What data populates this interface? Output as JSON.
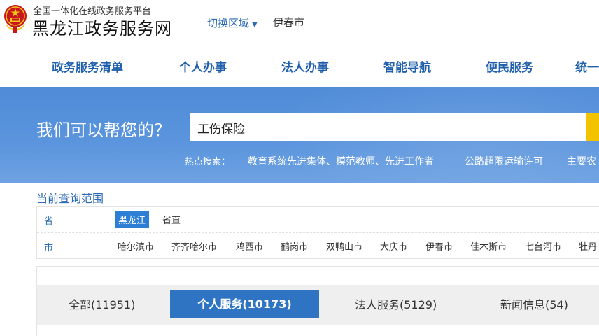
{
  "header": {
    "platform_subtitle": "全国一体化在线政务服务平台",
    "platform_title": "黑龙江政务服务网",
    "region_switch_label": "切换区域",
    "region_current": "伊春市"
  },
  "nav": {
    "items": [
      {
        "label": "政务服务清单"
      },
      {
        "label": "个人办事"
      },
      {
        "label": "法人办事"
      },
      {
        "label": "智能导航"
      },
      {
        "label": "便民服务"
      },
      {
        "label": "统一"
      }
    ]
  },
  "banner": {
    "prompt": "我们可以帮您的？",
    "search_value": "工伤保险",
    "hot_label": "热点搜索：",
    "hot_items": [
      {
        "label": "教育系统先进集体、模范教师、先进工作者"
      },
      {
        "label": "公路超限运输许可"
      },
      {
        "label": "主要农"
      }
    ]
  },
  "scope": {
    "title": "当前查询范围",
    "province_label": "省",
    "province_items": [
      {
        "label": "黑龙江"
      },
      {
        "label": "省直"
      }
    ],
    "city_label": "市",
    "city_items": [
      {
        "label": "哈尔滨市"
      },
      {
        "label": "齐齐哈尔市"
      },
      {
        "label": "鸡西市"
      },
      {
        "label": "鹤岗市"
      },
      {
        "label": "双鸭山市"
      },
      {
        "label": "大庆市"
      },
      {
        "label": "伊春市"
      },
      {
        "label": "佳木斯市"
      },
      {
        "label": "七台河市"
      },
      {
        "label": "牡丹"
      }
    ]
  },
  "tabs": [
    {
      "label": "全部(11951)"
    },
    {
      "label": "个人服务(10173)"
    },
    {
      "label": "法人服务(5129)"
    },
    {
      "label": "新闻信息(54)"
    }
  ],
  "colors": {
    "accent": "#2f74c2",
    "nav_text": "#1f5fab",
    "banner": "#5a94dd",
    "search_button": "#f3c300",
    "emblem_red": "#c8161d",
    "emblem_gold": "#f2c318"
  },
  "icons": {
    "emblem": "national-emblem",
    "region_caret": "caret-down-icon"
  }
}
